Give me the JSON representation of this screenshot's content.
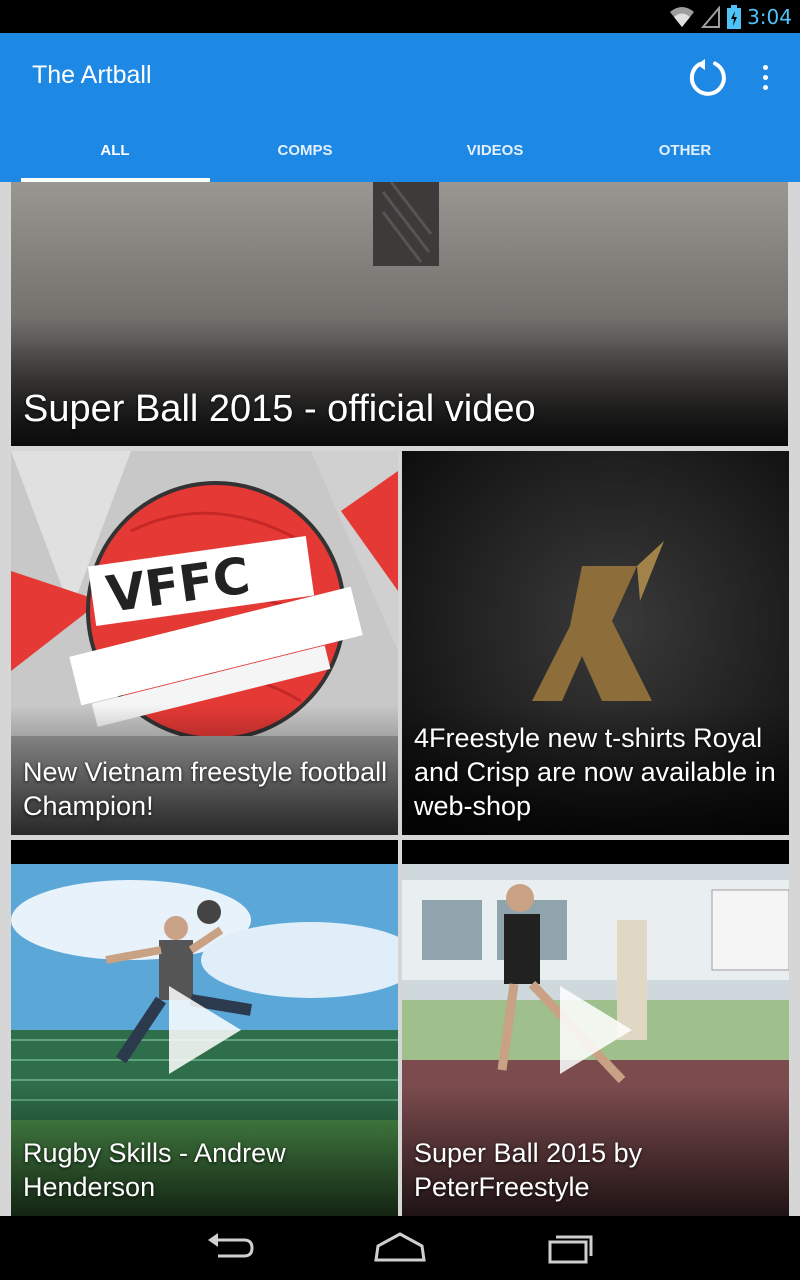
{
  "status_bar": {
    "time": "3:04",
    "icons": [
      "wifi-icon",
      "cell-signal-icon",
      "battery-charging-icon"
    ]
  },
  "app_bar": {
    "title": "The Artball",
    "actions": [
      "refresh-icon",
      "overflow-menu-icon"
    ]
  },
  "tabs": [
    {
      "label": "ALL",
      "selected": true
    },
    {
      "label": "COMPS",
      "selected": false
    },
    {
      "label": "VIDEOS",
      "selected": false
    },
    {
      "label": "OTHER",
      "selected": false
    }
  ],
  "feed": [
    {
      "title": "Super Ball 2015 - official video",
      "has_play": false
    },
    {
      "title": "New Vietnam freestyle football Champion!",
      "has_play": false
    },
    {
      "title": "4Freestyle new t-shirts Royal and Crisp are now available in web-shop",
      "has_play": false
    },
    {
      "title": "Rugby Skills - Andrew Henderson",
      "has_play": true
    },
    {
      "title": "Super Ball 2015 by PeterFreestyle",
      "has_play": true
    }
  ],
  "nav_bar": {
    "buttons": [
      "back-icon",
      "home-icon",
      "recent-apps-icon"
    ]
  }
}
